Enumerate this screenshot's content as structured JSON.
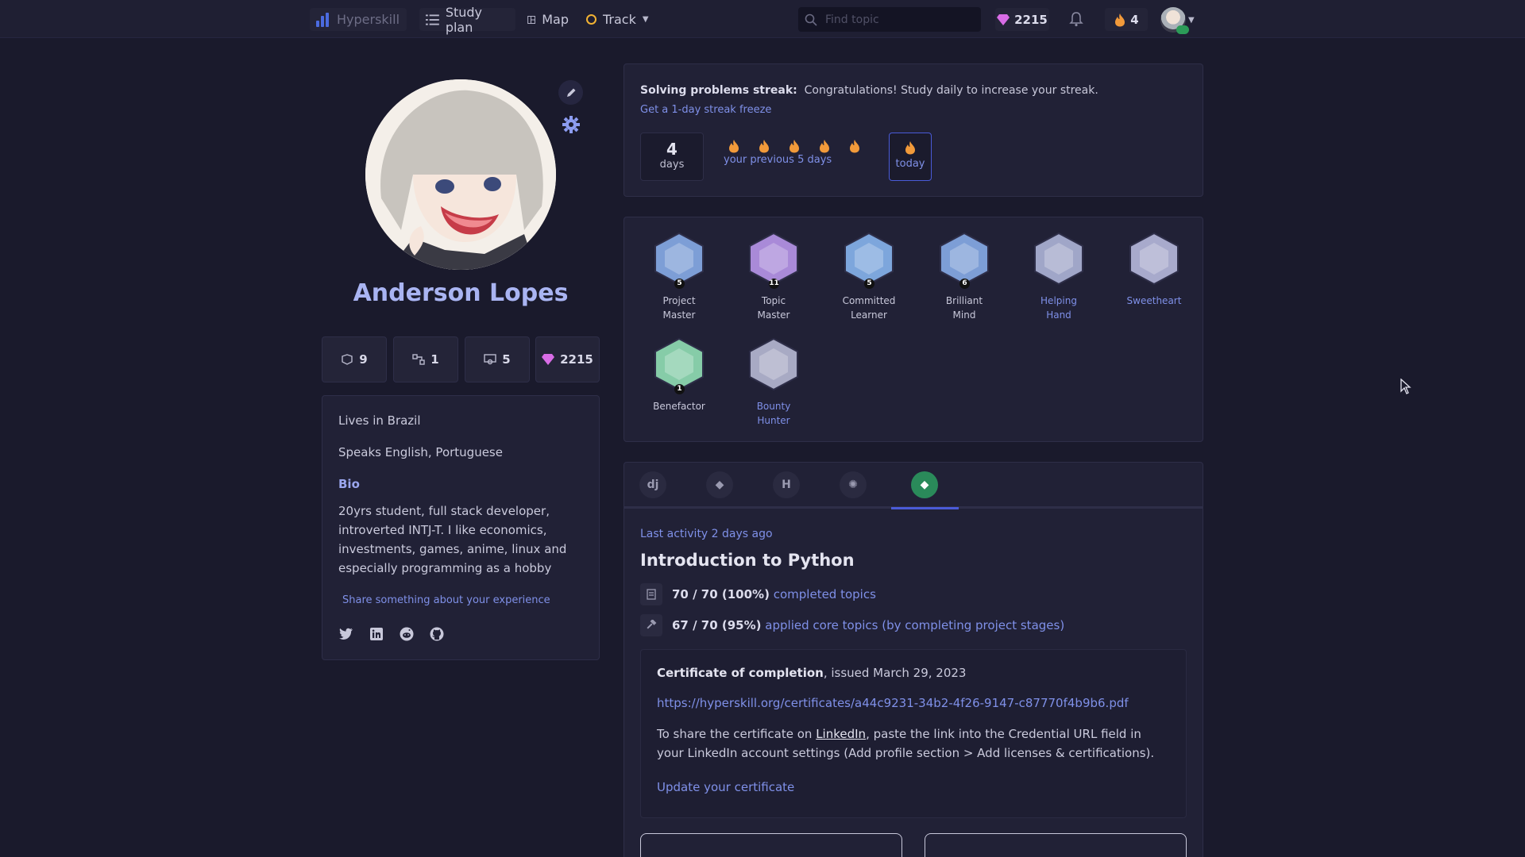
{
  "nav": {
    "logo": "Hyperskill",
    "study_plan": "Study plan",
    "map": "Map",
    "track": "Track",
    "search_placeholder": "Find topic",
    "gems": "2215",
    "streak": "4"
  },
  "profile": {
    "name": "Anderson Lopes",
    "stats": {
      "projects": "9",
      "topics": "1",
      "certificates": "5",
      "gems": "2215"
    },
    "location": "Lives in Brazil",
    "languages": "Speaks English, Portuguese",
    "bio_heading": "Bio",
    "bio": "20yrs student, full stack developer, introverted INTJ-T. I like economics, investments, games, anime, linux and especially programming as a hobby",
    "share_link": "Share something about your experience"
  },
  "streak": {
    "heading": "Solving problems streak:",
    "message": "Congratulations! Study daily to increase your streak.",
    "freeze_link": "Get a 1-day streak freeze",
    "days_value": "4",
    "days_unit": "days",
    "previous_label": "your previous 5 days",
    "today_label": "today"
  },
  "badges": [
    {
      "line1": "Project",
      "line2": "Master",
      "level": "5",
      "color": "#7d9ed6"
    },
    {
      "line1": "Topic",
      "line2": "Master",
      "level": "11",
      "color": "#a98ad8"
    },
    {
      "line1": "Committed",
      "line2": "Learner",
      "level": "5",
      "color": "#7da6dc"
    },
    {
      "line1": "Brilliant",
      "line2": "Mind",
      "level": "6",
      "color": "#7d9ed6"
    },
    {
      "line1": "Helping",
      "line2": "Hand",
      "level": "",
      "color": "#a0a6c8"
    },
    {
      "line1": "Sweetheart",
      "line2": "",
      "level": "",
      "color": "#a8aacc"
    },
    {
      "line1": "Benefactor",
      "line2": "",
      "level": "1",
      "color": "#86cca8"
    },
    {
      "line1": "Bounty",
      "line2": "Hunter",
      "level": "",
      "color": "#a8aac4"
    }
  ],
  "track_tabs": [
    "dj",
    "py",
    "h5",
    "sp",
    "py-active"
  ],
  "track": {
    "last_activity": "Last activity 2 days ago",
    "title": "Introduction to Python",
    "completed_value": "70 / 70 (100%)",
    "completed_label": "completed topics",
    "applied_value": "67 / 70 (95%)",
    "applied_label": "applied core topics (by completing project stages)"
  },
  "certificate": {
    "title": "Certificate of completion",
    "issued": ", issued March 29, 2023",
    "url": "https://hyperskill.org/certificates/a44c9231-34b2-4f26-9147-c87770f4b9b6.pdf",
    "share_pre": "To share the certificate on ",
    "linkedin": "LinkedIn",
    "share_post": ", paste the link into the Credential URL field in your LinkedIn account settings (Add profile section > Add licenses & certifications).",
    "update_link": "Update your certificate"
  },
  "colors": {
    "accent": "#7f90e8",
    "background": "#1a1a2c",
    "card": "#212136",
    "flame": "#f29a3a",
    "gem": "#d86ce6"
  }
}
